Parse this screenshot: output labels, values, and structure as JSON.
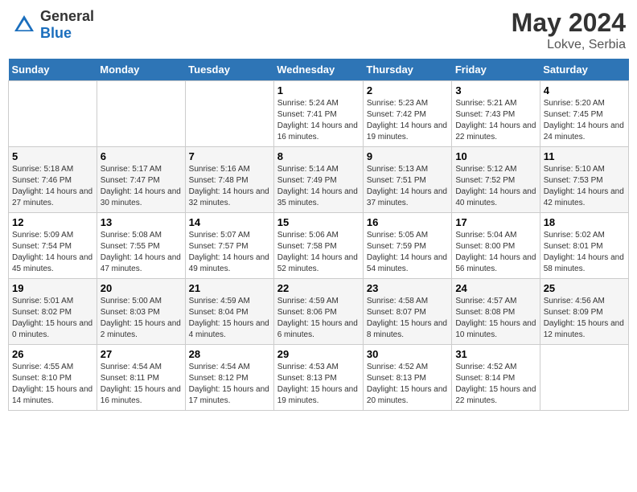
{
  "header": {
    "logo_general": "General",
    "logo_blue": "Blue",
    "month_year": "May 2024",
    "location": "Lokve, Serbia"
  },
  "days_of_week": [
    "Sunday",
    "Monday",
    "Tuesday",
    "Wednesday",
    "Thursday",
    "Friday",
    "Saturday"
  ],
  "weeks": [
    {
      "days": [
        {
          "number": "",
          "sunrise": "",
          "sunset": "",
          "daylight": ""
        },
        {
          "number": "",
          "sunrise": "",
          "sunset": "",
          "daylight": ""
        },
        {
          "number": "",
          "sunrise": "",
          "sunset": "",
          "daylight": ""
        },
        {
          "number": "1",
          "sunrise": "Sunrise: 5:24 AM",
          "sunset": "Sunset: 7:41 PM",
          "daylight": "Daylight: 14 hours and 16 minutes."
        },
        {
          "number": "2",
          "sunrise": "Sunrise: 5:23 AM",
          "sunset": "Sunset: 7:42 PM",
          "daylight": "Daylight: 14 hours and 19 minutes."
        },
        {
          "number": "3",
          "sunrise": "Sunrise: 5:21 AM",
          "sunset": "Sunset: 7:43 PM",
          "daylight": "Daylight: 14 hours and 22 minutes."
        },
        {
          "number": "4",
          "sunrise": "Sunrise: 5:20 AM",
          "sunset": "Sunset: 7:45 PM",
          "daylight": "Daylight: 14 hours and 24 minutes."
        }
      ]
    },
    {
      "days": [
        {
          "number": "5",
          "sunrise": "Sunrise: 5:18 AM",
          "sunset": "Sunset: 7:46 PM",
          "daylight": "Daylight: 14 hours and 27 minutes."
        },
        {
          "number": "6",
          "sunrise": "Sunrise: 5:17 AM",
          "sunset": "Sunset: 7:47 PM",
          "daylight": "Daylight: 14 hours and 30 minutes."
        },
        {
          "number": "7",
          "sunrise": "Sunrise: 5:16 AM",
          "sunset": "Sunset: 7:48 PM",
          "daylight": "Daylight: 14 hours and 32 minutes."
        },
        {
          "number": "8",
          "sunrise": "Sunrise: 5:14 AM",
          "sunset": "Sunset: 7:49 PM",
          "daylight": "Daylight: 14 hours and 35 minutes."
        },
        {
          "number": "9",
          "sunrise": "Sunrise: 5:13 AM",
          "sunset": "Sunset: 7:51 PM",
          "daylight": "Daylight: 14 hours and 37 minutes."
        },
        {
          "number": "10",
          "sunrise": "Sunrise: 5:12 AM",
          "sunset": "Sunset: 7:52 PM",
          "daylight": "Daylight: 14 hours and 40 minutes."
        },
        {
          "number": "11",
          "sunrise": "Sunrise: 5:10 AM",
          "sunset": "Sunset: 7:53 PM",
          "daylight": "Daylight: 14 hours and 42 minutes."
        }
      ]
    },
    {
      "days": [
        {
          "number": "12",
          "sunrise": "Sunrise: 5:09 AM",
          "sunset": "Sunset: 7:54 PM",
          "daylight": "Daylight: 14 hours and 45 minutes."
        },
        {
          "number": "13",
          "sunrise": "Sunrise: 5:08 AM",
          "sunset": "Sunset: 7:55 PM",
          "daylight": "Daylight: 14 hours and 47 minutes."
        },
        {
          "number": "14",
          "sunrise": "Sunrise: 5:07 AM",
          "sunset": "Sunset: 7:57 PM",
          "daylight": "Daylight: 14 hours and 49 minutes."
        },
        {
          "number": "15",
          "sunrise": "Sunrise: 5:06 AM",
          "sunset": "Sunset: 7:58 PM",
          "daylight": "Daylight: 14 hours and 52 minutes."
        },
        {
          "number": "16",
          "sunrise": "Sunrise: 5:05 AM",
          "sunset": "Sunset: 7:59 PM",
          "daylight": "Daylight: 14 hours and 54 minutes."
        },
        {
          "number": "17",
          "sunrise": "Sunrise: 5:04 AM",
          "sunset": "Sunset: 8:00 PM",
          "daylight": "Daylight: 14 hours and 56 minutes."
        },
        {
          "number": "18",
          "sunrise": "Sunrise: 5:02 AM",
          "sunset": "Sunset: 8:01 PM",
          "daylight": "Daylight: 14 hours and 58 minutes."
        }
      ]
    },
    {
      "days": [
        {
          "number": "19",
          "sunrise": "Sunrise: 5:01 AM",
          "sunset": "Sunset: 8:02 PM",
          "daylight": "Daylight: 15 hours and 0 minutes."
        },
        {
          "number": "20",
          "sunrise": "Sunrise: 5:00 AM",
          "sunset": "Sunset: 8:03 PM",
          "daylight": "Daylight: 15 hours and 2 minutes."
        },
        {
          "number": "21",
          "sunrise": "Sunrise: 4:59 AM",
          "sunset": "Sunset: 8:04 PM",
          "daylight": "Daylight: 15 hours and 4 minutes."
        },
        {
          "number": "22",
          "sunrise": "Sunrise: 4:59 AM",
          "sunset": "Sunset: 8:06 PM",
          "daylight": "Daylight: 15 hours and 6 minutes."
        },
        {
          "number": "23",
          "sunrise": "Sunrise: 4:58 AM",
          "sunset": "Sunset: 8:07 PM",
          "daylight": "Daylight: 15 hours and 8 minutes."
        },
        {
          "number": "24",
          "sunrise": "Sunrise: 4:57 AM",
          "sunset": "Sunset: 8:08 PM",
          "daylight": "Daylight: 15 hours and 10 minutes."
        },
        {
          "number": "25",
          "sunrise": "Sunrise: 4:56 AM",
          "sunset": "Sunset: 8:09 PM",
          "daylight": "Daylight: 15 hours and 12 minutes."
        }
      ]
    },
    {
      "days": [
        {
          "number": "26",
          "sunrise": "Sunrise: 4:55 AM",
          "sunset": "Sunset: 8:10 PM",
          "daylight": "Daylight: 15 hours and 14 minutes."
        },
        {
          "number": "27",
          "sunrise": "Sunrise: 4:54 AM",
          "sunset": "Sunset: 8:11 PM",
          "daylight": "Daylight: 15 hours and 16 minutes."
        },
        {
          "number": "28",
          "sunrise": "Sunrise: 4:54 AM",
          "sunset": "Sunset: 8:12 PM",
          "daylight": "Daylight: 15 hours and 17 minutes."
        },
        {
          "number": "29",
          "sunrise": "Sunrise: 4:53 AM",
          "sunset": "Sunset: 8:13 PM",
          "daylight": "Daylight: 15 hours and 19 minutes."
        },
        {
          "number": "30",
          "sunrise": "Sunrise: 4:52 AM",
          "sunset": "Sunset: 8:13 PM",
          "daylight": "Daylight: 15 hours and 20 minutes."
        },
        {
          "number": "31",
          "sunrise": "Sunrise: 4:52 AM",
          "sunset": "Sunset: 8:14 PM",
          "daylight": "Daylight: 15 hours and 22 minutes."
        },
        {
          "number": "",
          "sunrise": "",
          "sunset": "",
          "daylight": ""
        }
      ]
    }
  ]
}
